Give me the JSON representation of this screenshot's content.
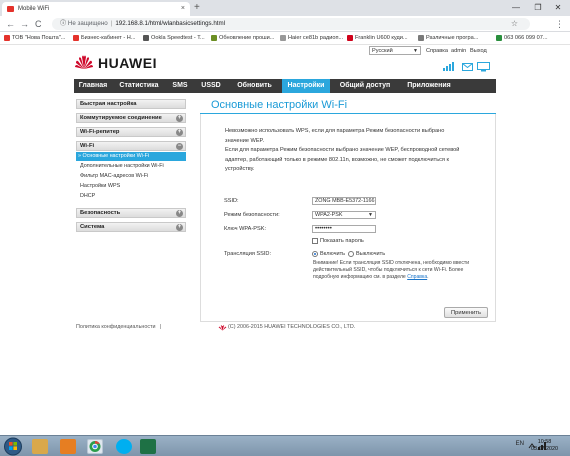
{
  "browser": {
    "tab_title": "Mobile WiFi",
    "tab_close": "×",
    "new_tab": "+",
    "window_controls": [
      "—",
      "❐",
      "✕"
    ],
    "nav": {
      "back": "←",
      "forward": "→",
      "reload": "C"
    },
    "url_security": "Не защищено",
    "url_separator": "|",
    "url": "192.168.8.1/html/wlanbasicsettings.html",
    "star": "☆",
    "menu": "⋮",
    "bookmarks": [
      {
        "label": "ТОВ \"Нова Пошта\"...",
        "icon_color": "#e4322b"
      },
      {
        "label": "Бизнес-кабинет - Н...",
        "icon_color": "#e4322b"
      },
      {
        "label": "Ookla Speedtest - T...",
        "icon_color": "#555555"
      },
      {
        "label": "Обновление проши...",
        "icon_color": "#6b8e23"
      },
      {
        "label": "Haier ce81b радиоп...",
        "icon_color": "#999999"
      },
      {
        "label": "Franklin U600 куди...",
        "icon_color": "#d0021b"
      },
      {
        "label": "Различные програ...",
        "icon_color": "#7a7a7a"
      },
      {
        "label": "063 066 099 07...",
        "icon_color": "#2a8f3d"
      }
    ]
  },
  "header": {
    "language": "Русский",
    "links": {
      "help": "Справка",
      "user": "admin",
      "logout": "Выход"
    },
    "logo_text": "HUAWEI",
    "brand_color": "#cf0a2c",
    "status_icons": [
      "signal-icon",
      "sms-icon",
      "monitor-icon"
    ]
  },
  "nav": {
    "items": [
      {
        "label": "Главная",
        "active": false
      },
      {
        "label": "Статистика",
        "active": false
      },
      {
        "label": "SMS",
        "active": false
      },
      {
        "label": "USSD",
        "active": false
      },
      {
        "label": "Обновить",
        "active": false
      },
      {
        "label": "Настройки",
        "active": true
      },
      {
        "label": "Общий доступ",
        "active": false
      },
      {
        "label": "Приложения",
        "active": false
      }
    ]
  },
  "sidebar": {
    "sections": [
      {
        "label": "Быстрая настройка",
        "expander": ""
      },
      {
        "label": "Коммутируемое соединение",
        "expander": "+"
      },
      {
        "label": "Wi-Fi-репитер",
        "expander": "+"
      },
      {
        "label": "Wi-Fi",
        "expander": "−"
      },
      {
        "label": "Безопасность",
        "expander": "+"
      },
      {
        "label": "Система",
        "expander": "+"
      }
    ],
    "wifi_items": [
      {
        "label": "» Основные настройки Wi-Fi",
        "active": true
      },
      {
        "label": "Дополнительные настройки Wi-Fi",
        "active": false
      },
      {
        "label": "Фильтр MAC-адресов Wi-Fi",
        "active": false
      },
      {
        "label": "Настройки WPS",
        "active": false
      },
      {
        "label": "DHCP",
        "active": false
      }
    ]
  },
  "content": {
    "title": "Основные настройки Wi-Fi",
    "note1_line1": "Невозможно использовать WPS, если для параметра Режим безопасности выбрано",
    "note1_line2": "значение WEP.",
    "note2_line1": "Если для параметра Режим безопасности выбрано значение WEP, беспроводной сетевой",
    "note2_line2": "адаптер, работающий только в режиме 802.11n, возможно, не сможет подключиться к",
    "note2_line3": "устройству.",
    "ssid_label": "SSID:",
    "ssid_value": "ZONG MBB-E5372-1166",
    "security_label": "Режим безопасности:",
    "security_value": "WPA2-PSK",
    "key_label": "Ключ WPA-PSK:",
    "key_value": "••••••••",
    "show_password": "Показать пароль",
    "broadcast_label": "Трансляция SSID:",
    "broadcast_on": "Включить",
    "broadcast_off": "Выключить",
    "warning_line1": "Внимание! Если трансляция SSID отключена, необходимо ввести",
    "warning_line2": "действительный SSID, чтобы подключиться к сети Wi-Fi. Более",
    "warning_line3": "подробную информацию см. в разделе",
    "warning_link": "Справка",
    "warning_end": ".",
    "apply": "Применить"
  },
  "footer": {
    "privacy": "Политика конфиденциальности",
    "privacy_sep": "|",
    "copyright": "(C) 2006-2015 HUAWEI TECHNOLOGIES CO., LTD."
  },
  "taskbar": {
    "start_icon": "windows-start-icon",
    "apps": [
      {
        "name": "explorer-icon",
        "color": "#d9a84b"
      },
      {
        "name": "media-player-icon",
        "color": "#e67e22"
      },
      {
        "name": "firefox-icon",
        "color": "#e66000"
      },
      {
        "name": "chrome-icon",
        "color": "#2a9d4b"
      },
      {
        "name": "skype-icon",
        "color": "#00aff0"
      },
      {
        "name": "excel-icon",
        "color": "#1e7145"
      }
    ],
    "lang": "EN",
    "time": "10:58",
    "date": "03.07.2020"
  }
}
